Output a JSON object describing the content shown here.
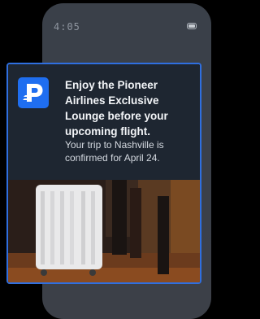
{
  "status_bar": {
    "time": "4:05"
  },
  "notification": {
    "headline": "Enjoy the Pioneer Airlines Exclusive Lounge before your upcoming flight.",
    "body": "Your trip to Nashville is confirmed for April 24.",
    "app_icon": "pioneer-airlines-p-logo",
    "accent_color": "#2f6fe0",
    "icon_color": "#1f6ef0"
  },
  "image": {
    "subject": "suitcase-at-airport-photo"
  }
}
